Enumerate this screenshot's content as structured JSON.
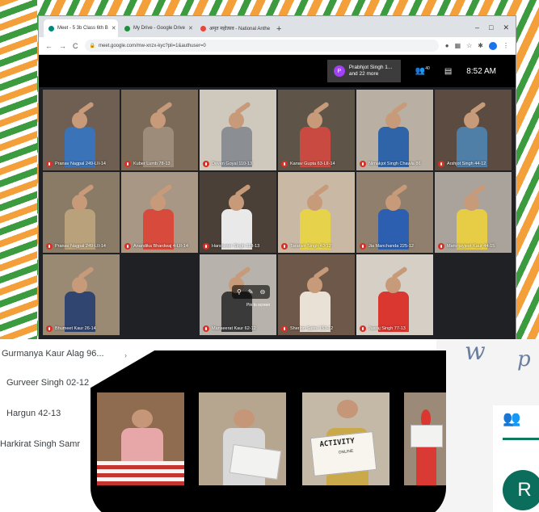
{
  "browser": {
    "tabs": [
      {
        "label": "Meet - 5 3b Class 6th B",
        "active": true,
        "favicon_color": "#00897b"
      },
      {
        "label": "My Drive - Google Drive",
        "active": false,
        "favicon_color": "#1e8e3e"
      },
      {
        "label": "अमृत महोत्सव - National Anthem",
        "active": false,
        "favicon_color": "#e8453c"
      }
    ],
    "new_tab": "+",
    "window_controls": [
      "–",
      "□",
      "✕"
    ],
    "url": "meet.google.com/mw-xnzx-kyc?pli=1&authuser=0",
    "nav": {
      "back": "←",
      "forward": "→",
      "reload": "C"
    }
  },
  "meet": {
    "presenter_initial": "P",
    "presenter_text": "Prabhjot Singh 1... and 22 more",
    "participants_icon": "people-icon",
    "participants_count": "40",
    "chat_icon": "chat-icon",
    "time": "8:52 AM",
    "pin_label": "Pin to screen",
    "tiles": [
      {
        "name": "Pranav Nagpal 249-LII-14",
        "shirt": "#3b73b8",
        "wall": "#6e5f52"
      },
      {
        "name": "Kuber Lumb 78-13",
        "shirt": "#9d8c7a",
        "wall": "#7c6a58"
      },
      {
        "name": "Deven Goyal 110-13",
        "shirt": "#8b8f93",
        "wall": "#cfc8bd"
      },
      {
        "name": "Kanav Gupta 63-LII-14",
        "shirt": "#c94a40",
        "wall": "#5e5448"
      },
      {
        "name": "Nimakjot Singh Chawla 86",
        "shirt": "#2f64a8",
        "wall": "#b9b0a3"
      },
      {
        "name": "Arshjot Singh 44-12",
        "shirt": "#4f7ea6",
        "wall": "#5b4b40"
      },
      {
        "name": "Pranav Nagpal 249-LII-14",
        "shirt": "#b9a27b",
        "wall": "#8a7b66"
      },
      {
        "name": "Anandika Bhardwaj 4-LII-14",
        "shirt": "#d84a3b",
        "wall": "#a89785"
      },
      {
        "name": "Harshveer Singh 113-13",
        "shirt": "#e9e9e9",
        "wall": "#4a4038"
      },
      {
        "name": "Taranvir Singh 40-12",
        "shirt": "#e7d34b",
        "wall": "#c9b8a4"
      },
      {
        "name": "Jia Manchanda 225-12",
        "shirt": "#2d5fb0",
        "wall": "#8f7f6c"
      },
      {
        "name": "Manvijayjeet Kaur 44-15",
        "shirt": "#e7cc45",
        "wall": "#a9a39b"
      },
      {
        "name": "Bhumeet Kaur 26-14",
        "shirt": "#30456f",
        "wall": "#9a8a74"
      },
      {
        "name": "",
        "shirt": "",
        "wall": ""
      },
      {
        "name": "Manseerat Kaur 62-12",
        "shirt": "#3a3a3a",
        "wall": "#b7b2ab"
      },
      {
        "name": "Sherlon Sahni 153-12",
        "shirt": "#e9e1d6",
        "wall": "#6e5849"
      },
      {
        "name": "Jasraj Singh 77-13",
        "shirt": "#d9372f",
        "wall": "#d6cfc6"
      },
      {
        "name": "",
        "shirt": "",
        "wall": ""
      }
    ]
  },
  "people_list": [
    {
      "name": "Gurmanya Kaur Alag 96..."
    },
    {
      "name": "Gurveer Singh 02-12"
    },
    {
      "name": "Hargun 42-13"
    },
    {
      "name": "Harkirat Singh Samr"
    }
  ],
  "collage": {
    "activity_text": "ACTIVITY",
    "online_text": "ONLINE",
    "photos": [
      {
        "shirt": "#e7a6a8",
        "bg": "#8f6b4f"
      },
      {
        "shirt": "#d9d9d9",
        "bg": "#b6a58f"
      },
      {
        "shirt": "#caa94a",
        "bg": "#c4b9a6"
      },
      {
        "shirt": "#d93a34",
        "bg": "#9b8a78"
      }
    ]
  },
  "handwriting": {
    "left": "w",
    "right": "p"
  },
  "side": {
    "people_icon": "people-icon",
    "avatar_initial": "R"
  }
}
